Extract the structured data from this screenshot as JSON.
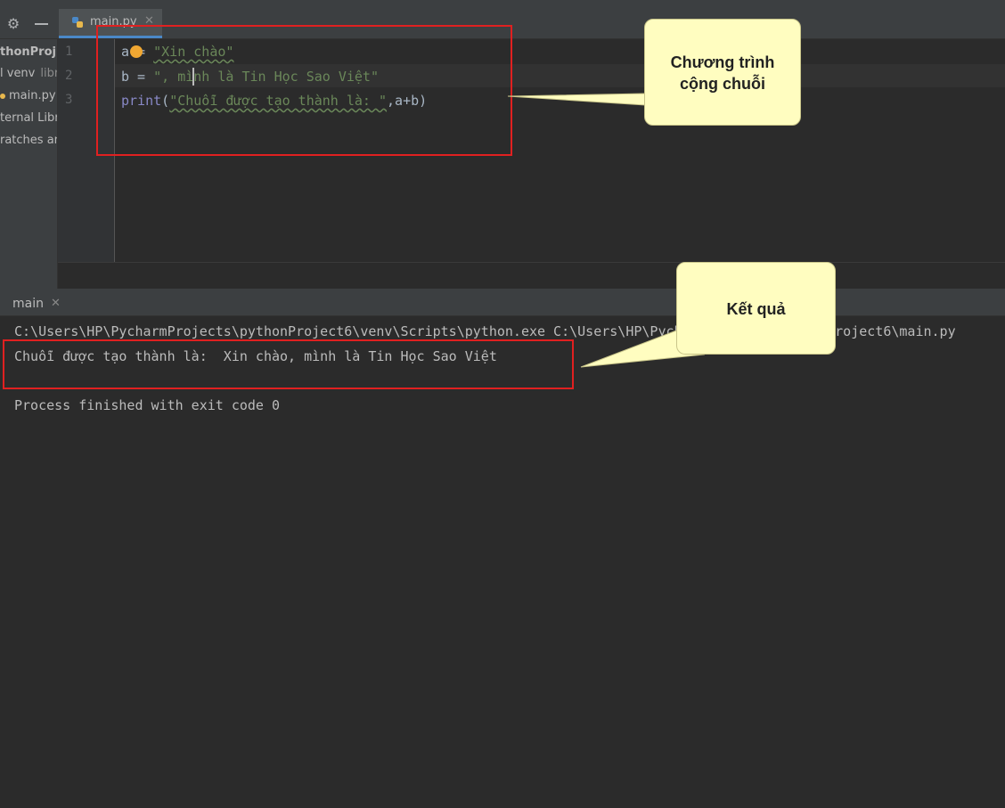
{
  "tab": {
    "file_name": "main.py"
  },
  "sidebar": {
    "project": "thonProj",
    "venv": "l venv",
    "venv_hint": "libr",
    "main_file": "main.py",
    "external_libs": "ternal Libr",
    "scratches": "ratches an"
  },
  "editor": {
    "line_numbers": [
      "1",
      "2",
      "3"
    ],
    "line1": {
      "var": "a",
      "op": " = ",
      "str": "\"Xin chào\""
    },
    "line2": {
      "var": "b",
      "op": " = ",
      "str": "\", mình là Tin Học Sao Việt\""
    },
    "line3": {
      "fn": "print",
      "open": "(",
      "str": "\"Chuỗi được tạo thành là: \"",
      "rest": ",a+b)"
    }
  },
  "run": {
    "tab_label": "main",
    "command": "C:\\Users\\HP\\PycharmProjects\\pythonProject6\\venv\\Scripts\\python.exe C:\\Users\\HP\\PycharmProjects\\pythonProject6\\main.py",
    "output": "Chuỗi được tạo thành là:  Xin chào, mình là Tin Học Sao Việt",
    "exit_message": "Process finished with exit code 0"
  },
  "callouts": {
    "program_line1": "Chương trình",
    "program_line2": "cộng chuỗi",
    "result": "Kết quả"
  },
  "colors": {
    "string": "#6a8759",
    "function": "#8888c6",
    "annotation_border": "#e02020",
    "callout_fill": "#fffdc0"
  }
}
